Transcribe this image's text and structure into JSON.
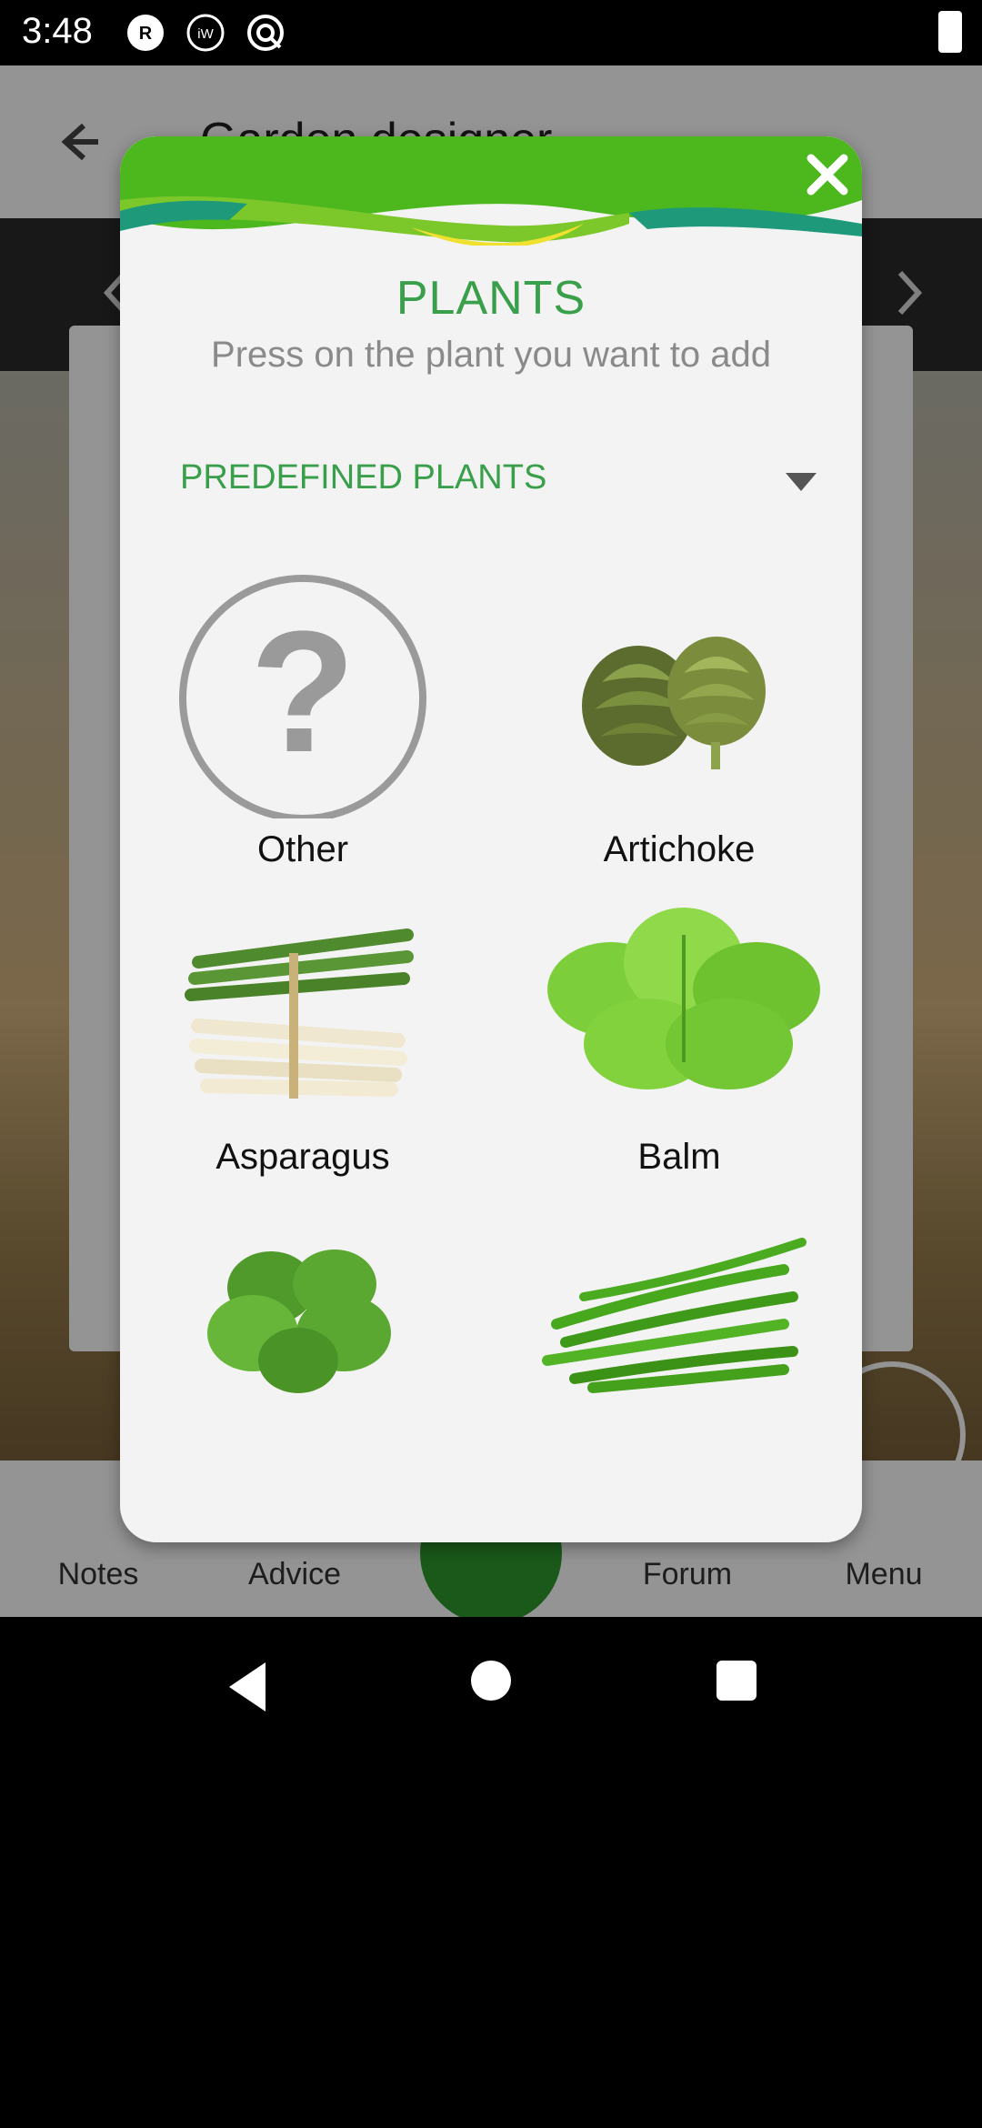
{
  "status_bar": {
    "time": "3:48",
    "icons": [
      "r-badge-icon",
      "iw-badge-icon",
      "target-icon",
      "battery-charging-icon"
    ]
  },
  "app": {
    "title": "Garden designer",
    "nav": {
      "notes": "Notes",
      "advice": "Advice",
      "forum": "Forum",
      "menu": "Menu"
    }
  },
  "dialog": {
    "title": "PLANTS",
    "subtitle": "Press on the plant you want to add",
    "dropdown": {
      "selected": "PREDEFINED PLANTS"
    },
    "plants": [
      {
        "label": "Other",
        "icon": "question-mark-icon"
      },
      {
        "label": "Artichoke",
        "icon": "artichoke-icon"
      },
      {
        "label": "Asparagus",
        "icon": "asparagus-icon"
      },
      {
        "label": "Balm",
        "icon": "balm-leaves-icon"
      },
      {
        "label": "",
        "icon": "basil-leaves-icon"
      },
      {
        "label": "",
        "icon": "green-beans-icon"
      }
    ]
  },
  "colors": {
    "accent_green": "#3a9f4b",
    "header_green": "#4cb81e",
    "dialog_bg": "#f3f3f3"
  }
}
